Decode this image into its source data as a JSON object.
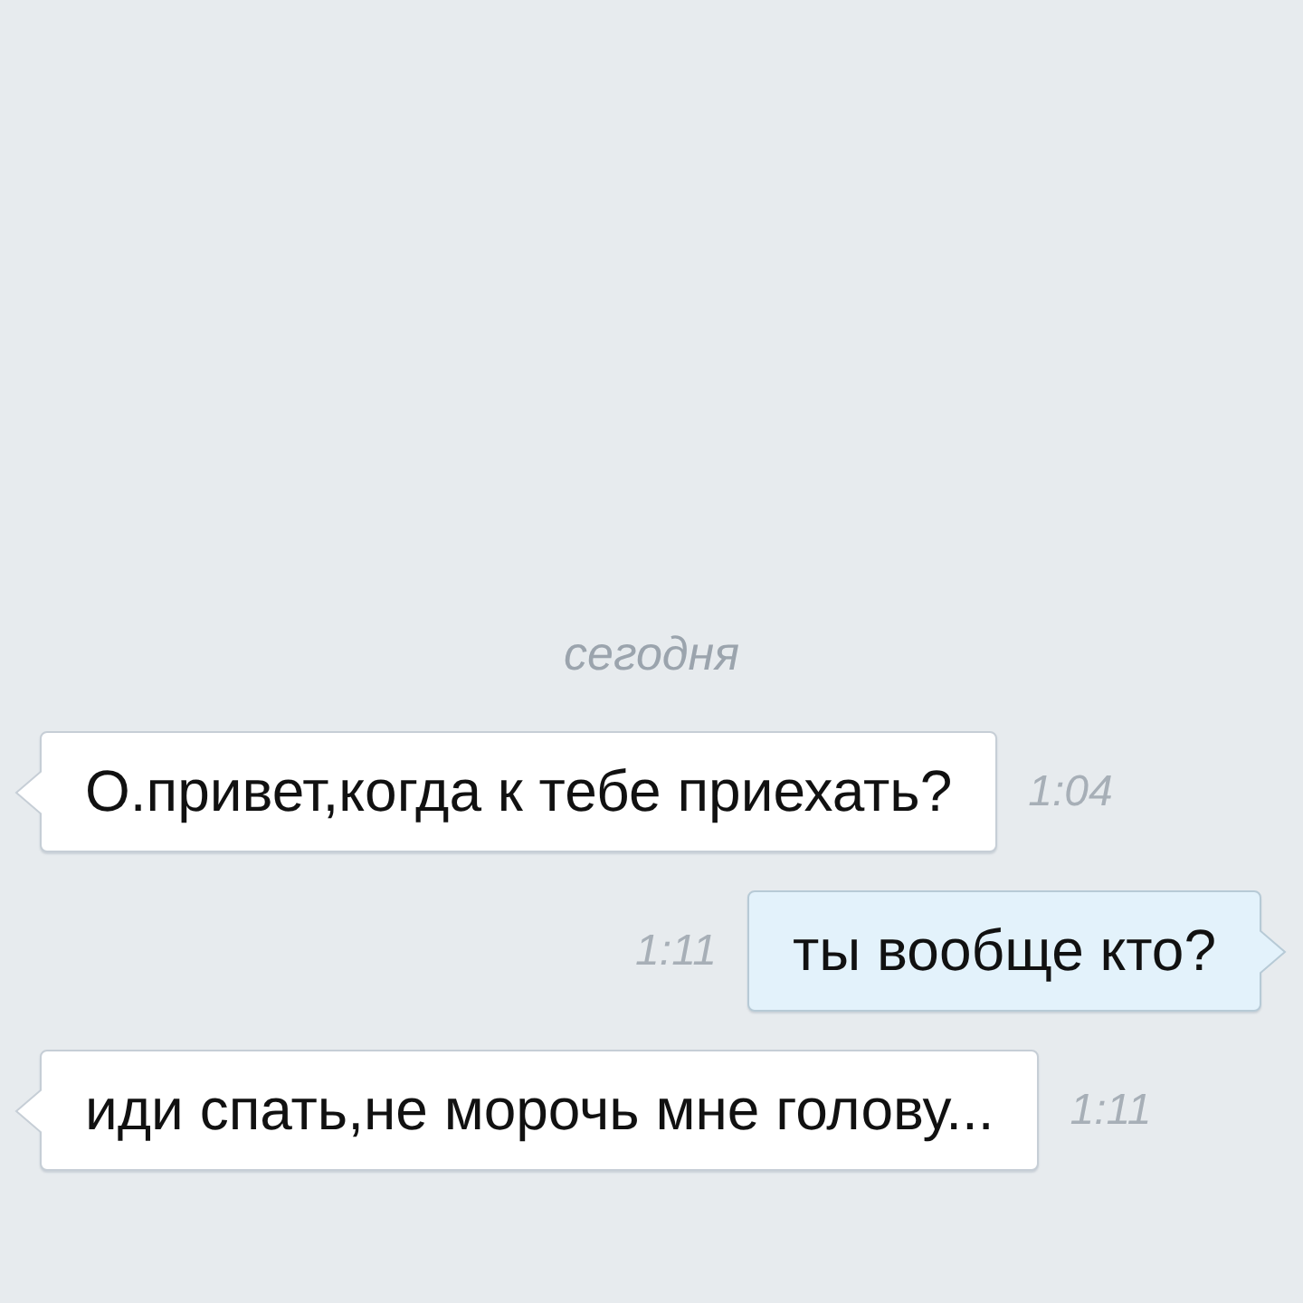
{
  "date_separator": {
    "label": "сегодня"
  },
  "messages": [
    {
      "kind": "incoming",
      "text": "О.привет,когда к тебе приехать?",
      "time": "1:04"
    },
    {
      "kind": "outgoing",
      "text": "ты вообще кто?",
      "time": "1:11"
    },
    {
      "kind": "incoming",
      "text": "иди спать,не морочь мне голову...",
      "time": "1:11"
    }
  ]
}
